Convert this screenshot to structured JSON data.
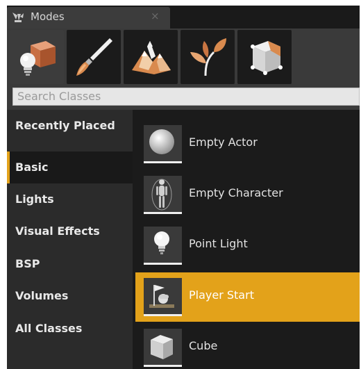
{
  "tab": {
    "title": "Modes",
    "close": "×"
  },
  "modes": [
    {
      "name": "place-mode",
      "icon": "cube-bulb-icon"
    },
    {
      "name": "paint-mode",
      "icon": "brush-icon"
    },
    {
      "name": "landscape-mode",
      "icon": "mountains-icon"
    },
    {
      "name": "foliage-mode",
      "icon": "leaf-icon"
    },
    {
      "name": "geometry-mode",
      "icon": "geometry-cube-icon"
    }
  ],
  "search": {
    "placeholder": "Search Classes"
  },
  "categories": [
    {
      "label": "Recently Placed"
    },
    {
      "label": "Basic"
    },
    {
      "label": "Lights"
    },
    {
      "label": "Visual Effects"
    },
    {
      "label": "BSP"
    },
    {
      "label": "Volumes"
    },
    {
      "label": "All Classes"
    }
  ],
  "active_category": "Basic",
  "items": [
    {
      "label": "Empty Actor",
      "icon": "sphere-icon"
    },
    {
      "label": "Empty Character",
      "icon": "mannequin-icon"
    },
    {
      "label": "Point Light",
      "icon": "lightbulb-icon"
    },
    {
      "label": "Player Start",
      "icon": "flag-icon"
    },
    {
      "label": "Cube",
      "icon": "cube-icon"
    }
  ],
  "selected_item": "Player Start",
  "colors": {
    "accent": "#e3a21a",
    "panel": "#2b2b2b",
    "background": "#1b1b1b"
  }
}
